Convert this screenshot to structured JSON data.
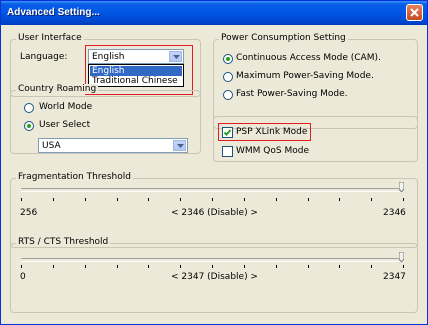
{
  "window": {
    "title": "Advanced Setting..."
  },
  "user_interface": {
    "title": "User Interface",
    "language_label": "Language:",
    "language_value": "English",
    "options": [
      "English",
      "Traditional Chinese"
    ]
  },
  "country_roaming": {
    "title": "Country Roaming",
    "world_mode": "World Mode",
    "user_select": "User Select",
    "country_value": "USA"
  },
  "power": {
    "title": "Power Consumption Setting",
    "cam": "Continuous Access Mode (CAM).",
    "max_saving": "Maximum Power-Saving Mode.",
    "fast_saving": "Fast Power-Saving Mode."
  },
  "modes": {
    "psp_xlink": "PSP XLink Mode",
    "wmm_qos": "WMM QoS Mode"
  },
  "fragmentation": {
    "title": "Fragmentation Threshold",
    "min": "256",
    "current": "< 2346 (Disable) >",
    "max": "2346",
    "level": 1.0
  },
  "rts_cts": {
    "title": "RTS / CTS Threshold",
    "min": "0",
    "current": "< 2347 (Disable) >",
    "max": "2347",
    "level": 1.0
  }
}
